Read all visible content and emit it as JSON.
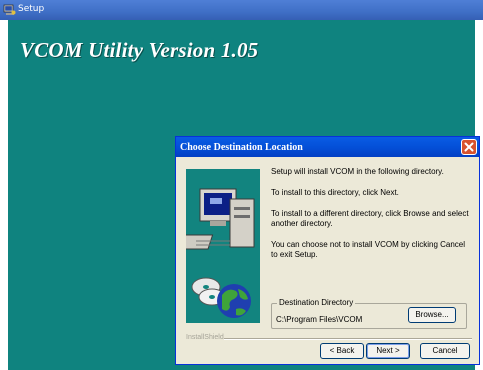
{
  "window": {
    "title": "Setup"
  },
  "banner": {
    "text": "VCOM Utility Version 1.05"
  },
  "dialog": {
    "title": "Choose Destination Location",
    "messages": [
      "Setup will install VCOM in the following directory.",
      "To install to this directory, click Next.",
      "To install to a different directory, click Browse and select another directory.",
      "You can choose not to install VCOM by clicking Cancel to exit Setup."
    ],
    "destination": {
      "legend": "Destination Directory",
      "path": "C:\\Program Files\\VCOM",
      "browse_label": "Browse..."
    },
    "installshield_label": "InstallShield",
    "buttons": {
      "back": "< Back",
      "next": "Next >",
      "cancel": "Cancel"
    }
  },
  "colors": {
    "desktop": "#0f837f",
    "title_bar": "#0450d8",
    "dialog_face": "#ece9d8"
  },
  "icons": [
    "setup-app-icon",
    "close-icon",
    "computer-icon",
    "disks-icon",
    "globe-icon"
  ]
}
